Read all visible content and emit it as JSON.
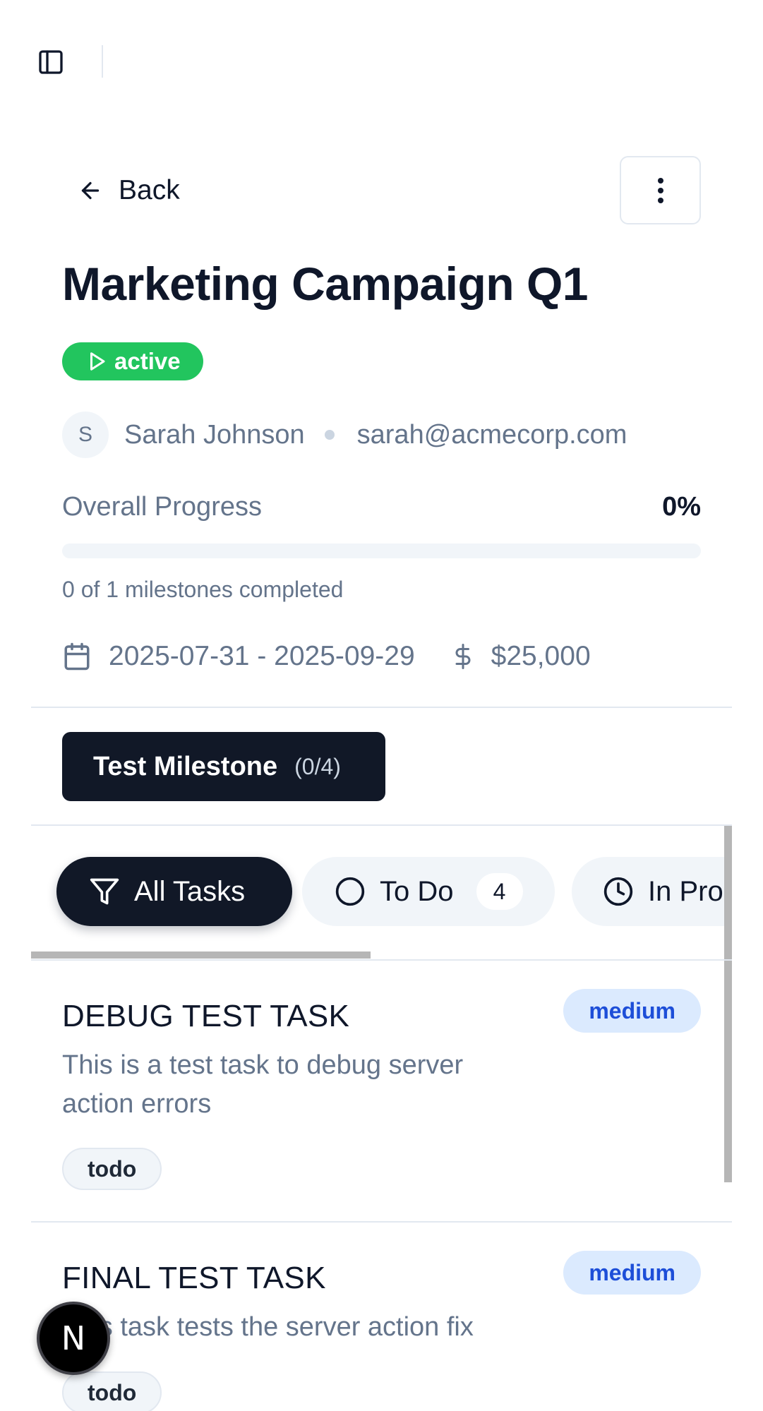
{
  "header": {
    "back_label": "Back"
  },
  "project": {
    "title": "Marketing Campaign Q1",
    "status": "active",
    "owner_initial": "S",
    "owner_name": "Sarah Johnson",
    "owner_email": "sarah@acmecorp.com",
    "progress_label": "Overall Progress",
    "progress_value": "0%",
    "progress_fraction": 0,
    "milestones_text": "0 of 1 milestones completed",
    "date_range": "2025-07-31 - 2025-09-29",
    "budget": "$25,000"
  },
  "milestone_tabs": [
    {
      "label": "Test Milestone",
      "count": "(0/4)"
    }
  ],
  "filters": [
    {
      "label": "All Tasks",
      "icon": "filter-icon",
      "active": true
    },
    {
      "label": "To Do",
      "icon": "circle-icon",
      "count": "4"
    },
    {
      "label": "In Progress",
      "icon": "clock-icon"
    }
  ],
  "tasks": [
    {
      "title": "DEBUG TEST TASK",
      "description": "This is a test task to debug server action errors",
      "priority": "medium",
      "status": "todo"
    },
    {
      "title": "FINAL TEST TASK",
      "description": "This task tests the server action fix",
      "priority": "medium",
      "status": "todo"
    }
  ],
  "dev_badge": {
    "letter": "N"
  },
  "colors": {
    "primary_dark": "#111827",
    "status_active": "#22c55e",
    "priority_medium_bg": "#dbeafe",
    "priority_medium_text": "#1d4ed8",
    "muted_text": "#64748b"
  }
}
